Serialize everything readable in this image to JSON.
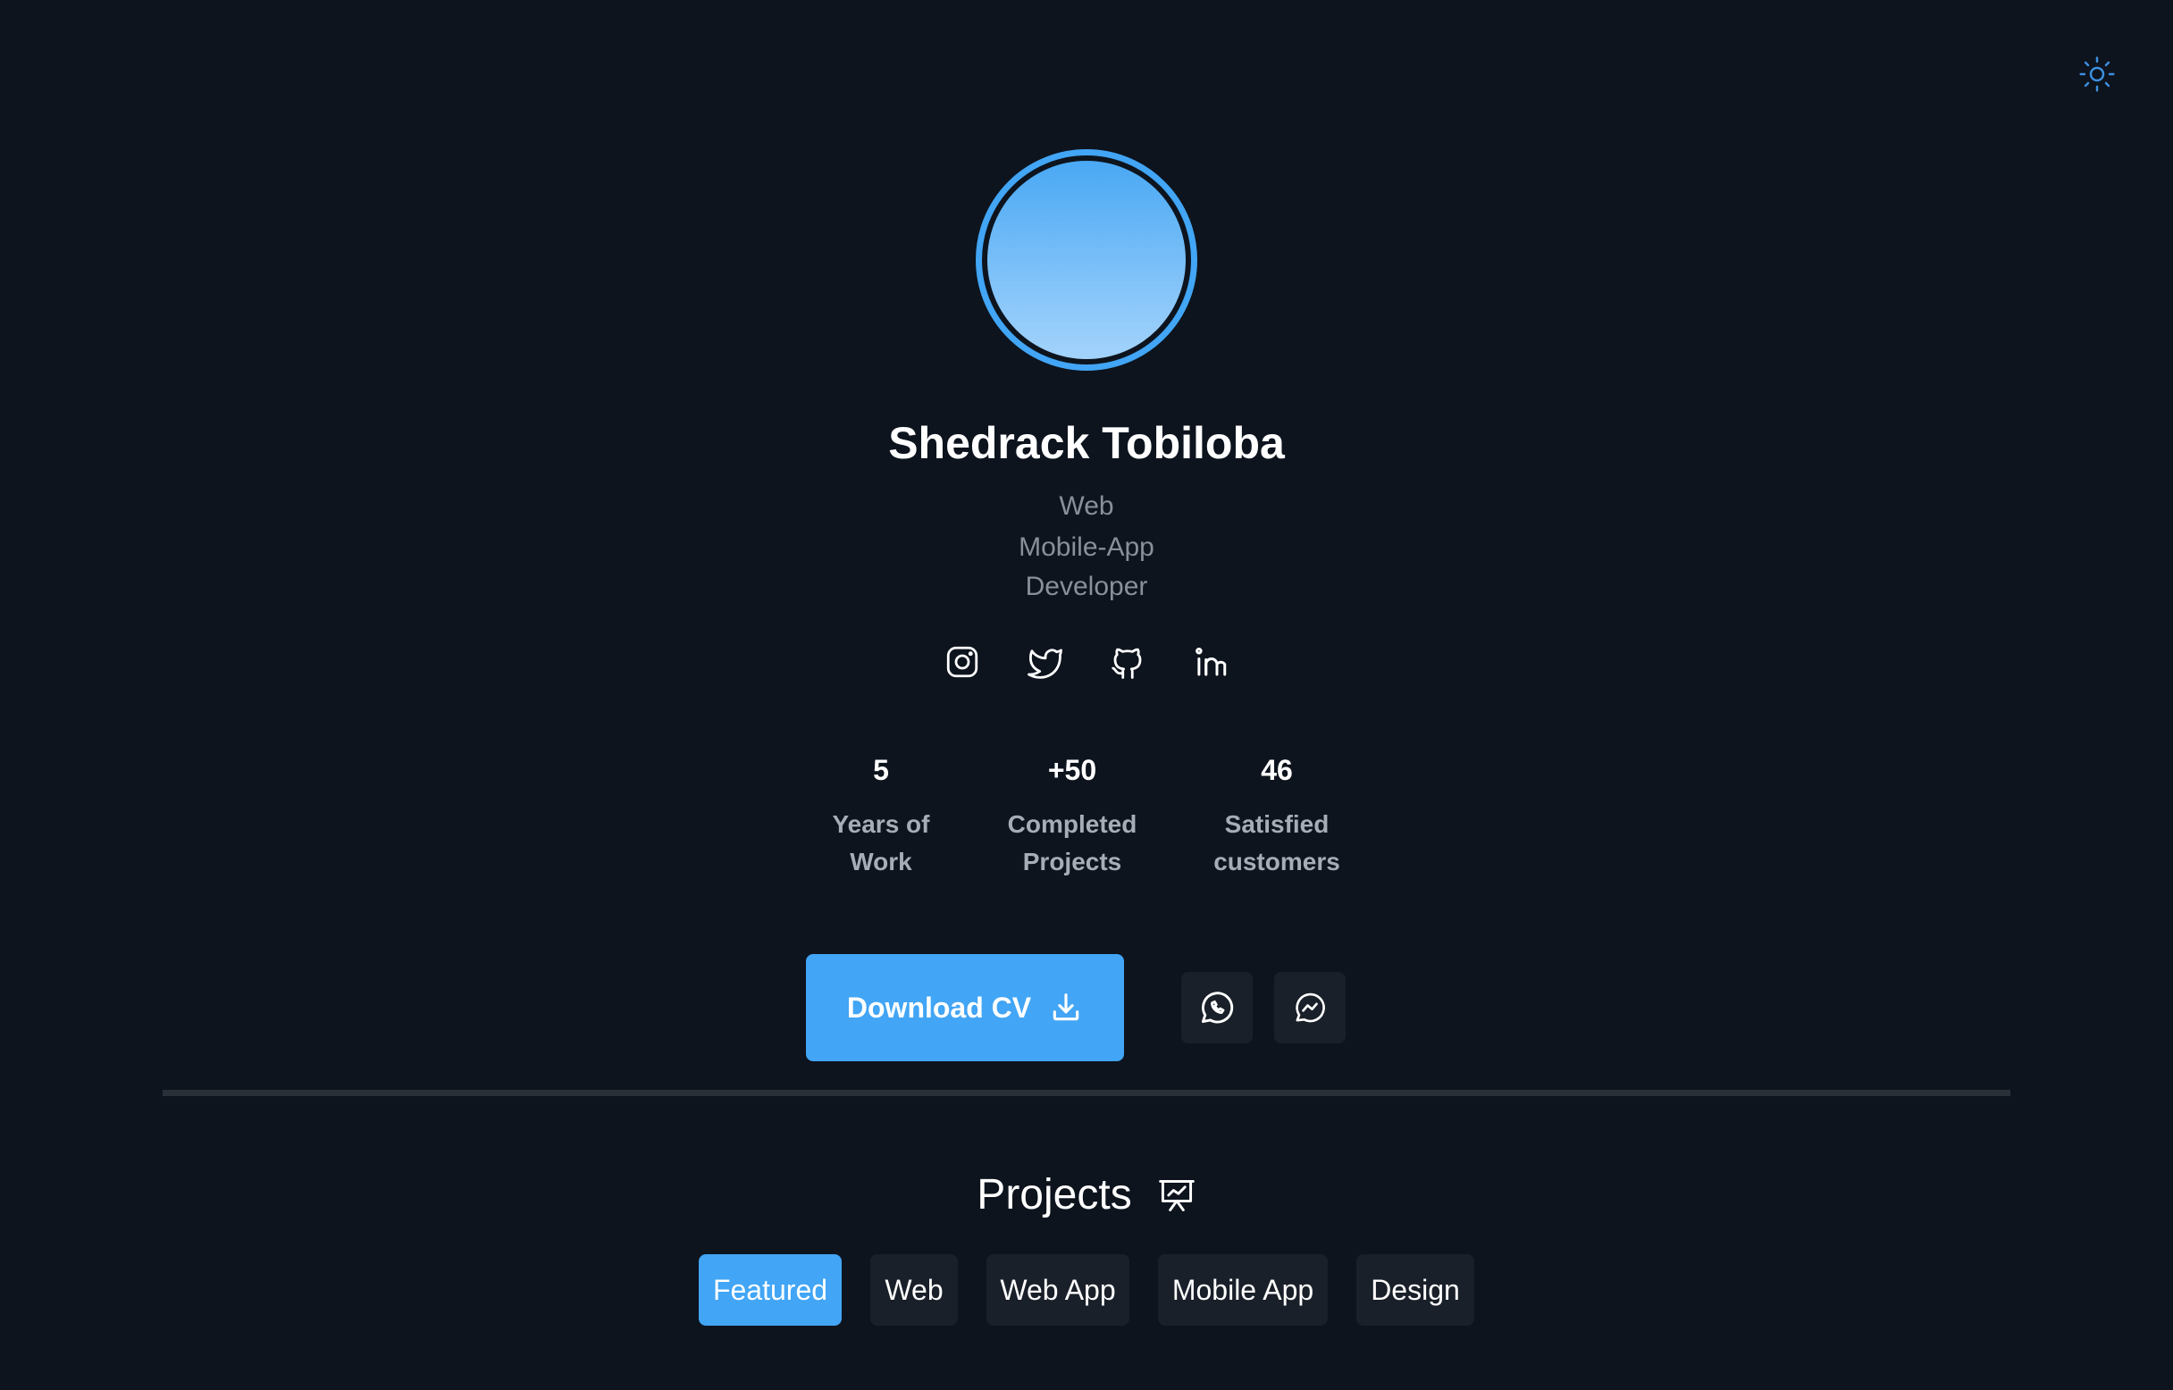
{
  "header": {
    "theme_toggle_icon": "sun-icon"
  },
  "profile": {
    "avatar_icon": "avatar",
    "name": "Shedrack Tobiloba",
    "role_lines": [
      "Web",
      "Mobile-App",
      "Developer"
    ]
  },
  "socials": [
    {
      "icon": "instagram-icon"
    },
    {
      "icon": "twitter-icon"
    },
    {
      "icon": "github-icon"
    },
    {
      "icon": "linkedin-icon"
    }
  ],
  "stats": [
    {
      "value": "5",
      "label_line1": "Years of",
      "label_line2": "Work"
    },
    {
      "value": "+50",
      "label_line1": "Completed",
      "label_line2": "Projects"
    },
    {
      "value": "46",
      "label_line1": "Satisfied",
      "label_line2": "customers"
    }
  ],
  "actions": {
    "download_label": "Download CV",
    "download_icon": "download-icon",
    "whatsapp_icon": "whatsapp-icon",
    "messenger_icon": "messenger-icon"
  },
  "projects": {
    "title": "Projects",
    "icon": "presentation-chart-icon",
    "tabs": [
      {
        "label": "Featured",
        "active": true
      },
      {
        "label": "Web",
        "active": false
      },
      {
        "label": "Web App",
        "active": false
      },
      {
        "label": "Mobile App",
        "active": false
      },
      {
        "label": "Design",
        "active": false
      }
    ]
  },
  "colors": {
    "background": "#0d141e",
    "accent": "#42a5f5",
    "muted_text": "#8a8f98",
    "stat_label": "#a7adb6",
    "chip_bg": "#1a2029",
    "divider": "#2a3037"
  }
}
